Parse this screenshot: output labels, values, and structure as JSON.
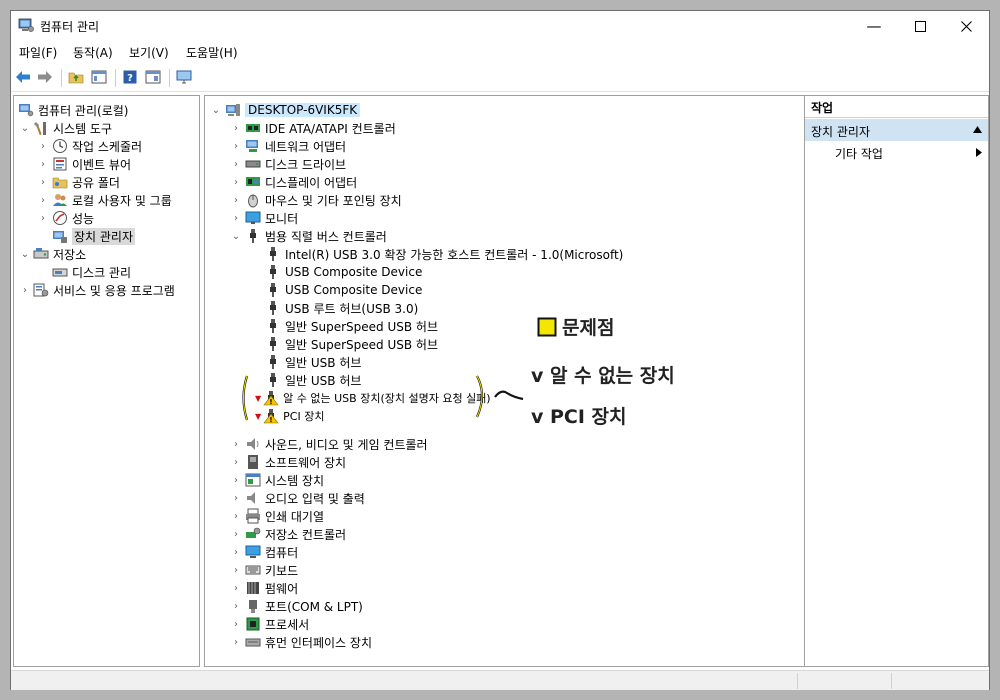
{
  "window": {
    "title": "컴퓨터 관리"
  },
  "menu": [
    "파일(F)",
    "동작(A)",
    "보기(V)",
    "도움말(H)"
  ],
  "left_tree": {
    "root": "컴퓨터 관리(로컬)",
    "system_tools": "시스템 도구",
    "task_scheduler": "작업 스케줄러",
    "event_viewer": "이벤트 뷰어",
    "shared_folders": "공유 폴더",
    "local_users": "로컬 사용자 및 그룹",
    "performance": "성능",
    "device_manager": "장치 관리자",
    "storage": "저장소",
    "disk_management": "디스크 관리",
    "services_apps": "서비스 및 응용 프로그램"
  },
  "device_tree": {
    "root": "DESKTOP-6VIK5FK",
    "before_usb": [
      "IDE ATA/ATAPI 컨트롤러",
      "네트워크 어댑터",
      "디스크 드라이브",
      "디스플레이 어댑터",
      "마우스 및 기타 포인팅 장치",
      "모니터"
    ],
    "usb_category": "범용 직렬 버스 컨트롤러",
    "usb_children": [
      "Intel(R) USB 3.0 확장 가능한 호스트 컨트롤러 - 1.0(Microsoft)",
      "USB Composite Device",
      "USB Composite Device",
      "USB 루트 허브(USB 3.0)",
      "일반 SuperSpeed USB 허브",
      "일반 SuperSpeed USB 허브",
      "일반 USB 허브",
      "일반 USB 허브"
    ],
    "problem_devices": [
      "알 수 없는 USB 장치(장치 설명자 요청 실패)",
      "PCI 장치"
    ],
    "after_usb": [
      "사운드, 비디오 및 게임 컨트롤러",
      "소프트웨어 장치",
      "시스템 장치",
      "오디오 입력 및 출력",
      "인쇄 대기열",
      "저장소 컨트롤러",
      "컴퓨터",
      "키보드",
      "펌웨어",
      "포트(COM & LPT)",
      "프로세서",
      "휴먼 인터페이스 장치"
    ]
  },
  "actions": {
    "header": "작업",
    "section": "장치 관리자",
    "more": "기타 작업"
  },
  "annotations": {
    "legend": "문제점",
    "unknown": "v 알 수 없는 장치",
    "pci": "v PCI 장치"
  }
}
